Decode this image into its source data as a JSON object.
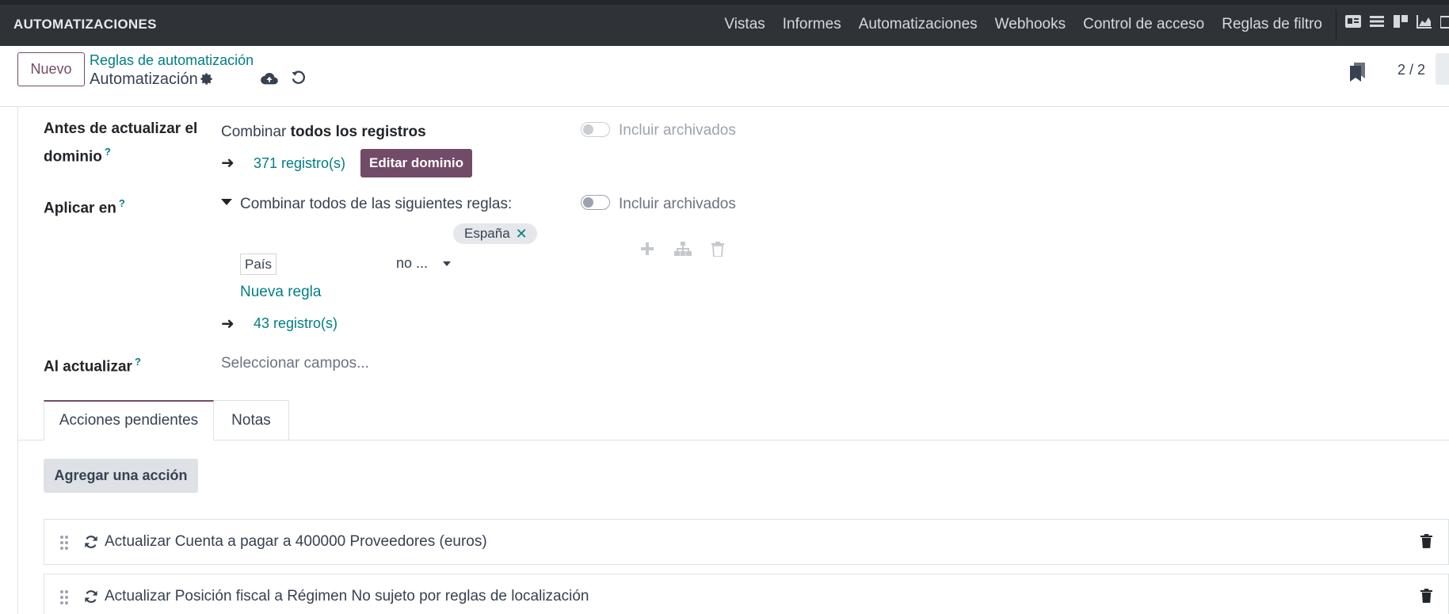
{
  "navbar": {
    "brand": "AUTOMATIZACIONES",
    "menu": [
      {
        "label": "Vistas"
      },
      {
        "label": "Informes"
      },
      {
        "label": "Automatizaciones"
      },
      {
        "label": "Webhooks"
      },
      {
        "label": "Control de acceso"
      },
      {
        "label": "Reglas de filtro"
      }
    ],
    "view_icons": [
      "id-card-icon",
      "list-icon",
      "kanban-icon",
      "area-chart-icon",
      "calendar-icon"
    ]
  },
  "control_panel": {
    "new_label": "Nuevo",
    "breadcrumb": "Reglas de automatización",
    "record_title": "Automatización",
    "pager": "2 / 2"
  },
  "form": {
    "before_update": {
      "label": "Antes de actualizar el dominio",
      "help": "?",
      "combine_prefix": "Combinar",
      "combine_bold": "todos los registros",
      "records_link": "371 registro(s)",
      "edit_domain_label": "Editar dominio",
      "include_archived": "Incluir archivados"
    },
    "apply_on": {
      "label": "Aplicar en",
      "help": "?",
      "combine_text": "Combinar todos de las siguientes reglas:",
      "include_archived": "Incluir archivados",
      "rule": {
        "field": "País",
        "operator": "no ...",
        "value_tag": "España"
      },
      "new_rule": "Nueva regla",
      "records_link": "43 registro(s)"
    },
    "on_update": {
      "label": "Al actualizar",
      "help": "?",
      "placeholder": "Seleccionar campos..."
    }
  },
  "notebook": {
    "tabs": [
      {
        "label": "Acciones pendientes",
        "active": true
      },
      {
        "label": "Notas",
        "active": false
      }
    ],
    "add_action_label": "Agregar una acción",
    "actions": [
      {
        "text": "Actualizar Cuenta a pagar a 400000 Proveedores (euros)"
      },
      {
        "text": "Actualizar Posición fiscal a Régimen No sujeto por reglas de localización"
      }
    ]
  },
  "colors": {
    "brand": "#714b67",
    "link": "#017e84",
    "navbar": "#2f3338"
  }
}
